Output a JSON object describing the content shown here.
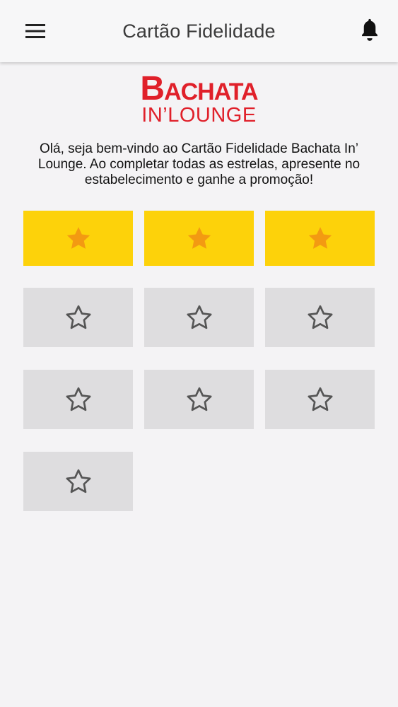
{
  "app_bar": {
    "title": "Cartão Fidelidade",
    "menu_icon": "menu-icon",
    "notification_icon": "bell-icon"
  },
  "logo": {
    "line1_b": "B",
    "line1_rest": "ACHATA",
    "line2": "IN’LOUNGE"
  },
  "welcome_text": "Olá, seja bem-vindo ao Cartão Fidelidade Bachata In’ Lounge. Ao completar todas as estrelas, apresente no estabelecimento e ganhe a promoção!",
  "stamps": {
    "filled_count": 3,
    "total": 10,
    "filled_icon": "star-filled-icon",
    "empty_icon": "star-outline-icon"
  },
  "colors": {
    "brand_red": "#e0202a",
    "stamp_filled_bg": "#fdd20a",
    "star_filled": "#f39a12",
    "stamp_empty_bg": "#dedddf",
    "star_empty_stroke": "#555555"
  }
}
